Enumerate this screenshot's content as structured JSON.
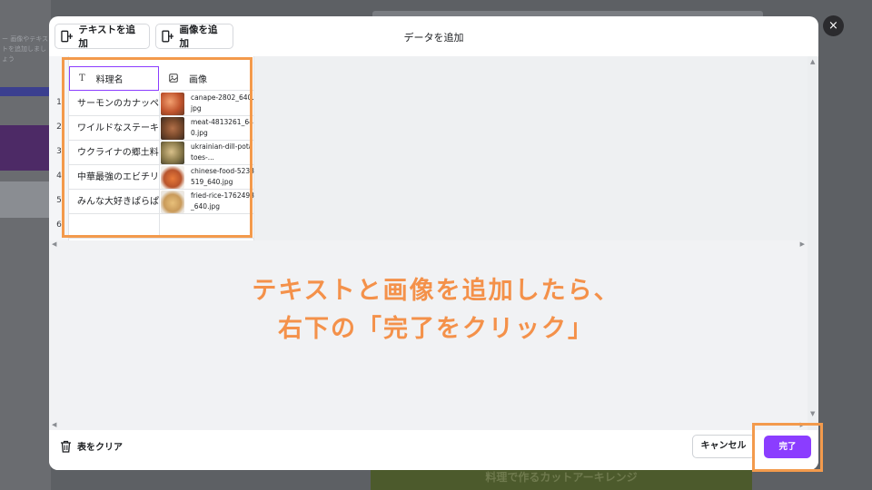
{
  "dialog": {
    "title": "データを追加",
    "close_icon": "×",
    "add_text_label": "テキストを追加",
    "add_image_label": "画像を追加"
  },
  "table": {
    "columns": [
      {
        "icon": "text-icon",
        "glyph": "T",
        "label": "料理名"
      },
      {
        "icon": "image-icon",
        "label": "画像"
      }
    ],
    "row_numbers": [
      "1",
      "2",
      "3",
      "4",
      "5",
      "6"
    ],
    "rows": [
      {
        "name": "サーモンのカナッペ",
        "image_file": "canape-2802_640.jpg",
        "thumb_color": "#c0532c"
      },
      {
        "name": "ワイルドなステーキ",
        "image_file": "meat-4813261_640.jpg",
        "thumb_color": "#7a4a2c"
      },
      {
        "name": "ウクライナの郷土料理",
        "image_file": "ukrainian-dill-potatoes-...",
        "thumb_color": "#8a7a4a"
      },
      {
        "name": "中華最強のエビチリ",
        "image_file": "chinese-food-5233519_640.jpg",
        "thumb_color": "#b8542c"
      },
      {
        "name": "みんな大好きぱらぱらチャーハン",
        "image_file": "fried-rice-1762493_640.jpg",
        "thumb_color": "#c99a5a"
      }
    ]
  },
  "caption": {
    "line1": "テキストと画像を追加したら、",
    "line2": "右下の「完了をクリック」"
  },
  "footer": {
    "clear_label": "表をクリア",
    "cancel_label": "キャンセル",
    "done_label": "完了"
  },
  "background": {
    "left_text": "ー 画像やテキストを追加しましょう",
    "bottom_banner": "料理で作るカットアーキレンジ"
  },
  "colors": {
    "accent": "#8b3dff",
    "highlight": "#f39a4c",
    "caption": "#f4914a"
  }
}
